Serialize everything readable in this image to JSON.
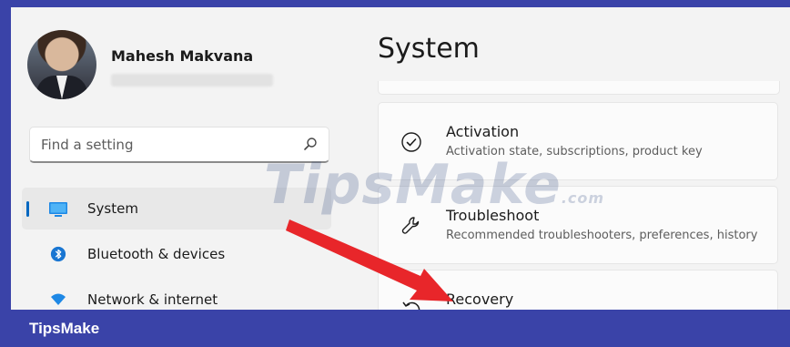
{
  "profile": {
    "name": "Mahesh Makvana"
  },
  "search": {
    "placeholder": "Find a setting"
  },
  "nav": {
    "items": [
      {
        "label": "System",
        "icon": "display-icon",
        "active": true
      },
      {
        "label": "Bluetooth & devices",
        "icon": "bluetooth-icon",
        "active": false
      },
      {
        "label": "Network & internet",
        "icon": "wifi-icon",
        "active": false
      }
    ]
  },
  "main": {
    "title": "System",
    "cards": [
      {
        "title": "Activation",
        "subtitle": "Activation state, subscriptions, product key",
        "icon": "check-circle-icon"
      },
      {
        "title": "Troubleshoot",
        "subtitle": "Recommended troubleshooters, preferences, history",
        "icon": "wrench-icon"
      },
      {
        "title": "Recovery",
        "subtitle": "",
        "icon": "recovery-icon"
      }
    ]
  },
  "watermark": {
    "text": "TipsMake",
    "suffix": ".com"
  },
  "footer": {
    "brand": "TipsMake"
  },
  "colors": {
    "accent": "#0067c0",
    "arrow": "#e8262a",
    "frame": "#3a43a8"
  }
}
